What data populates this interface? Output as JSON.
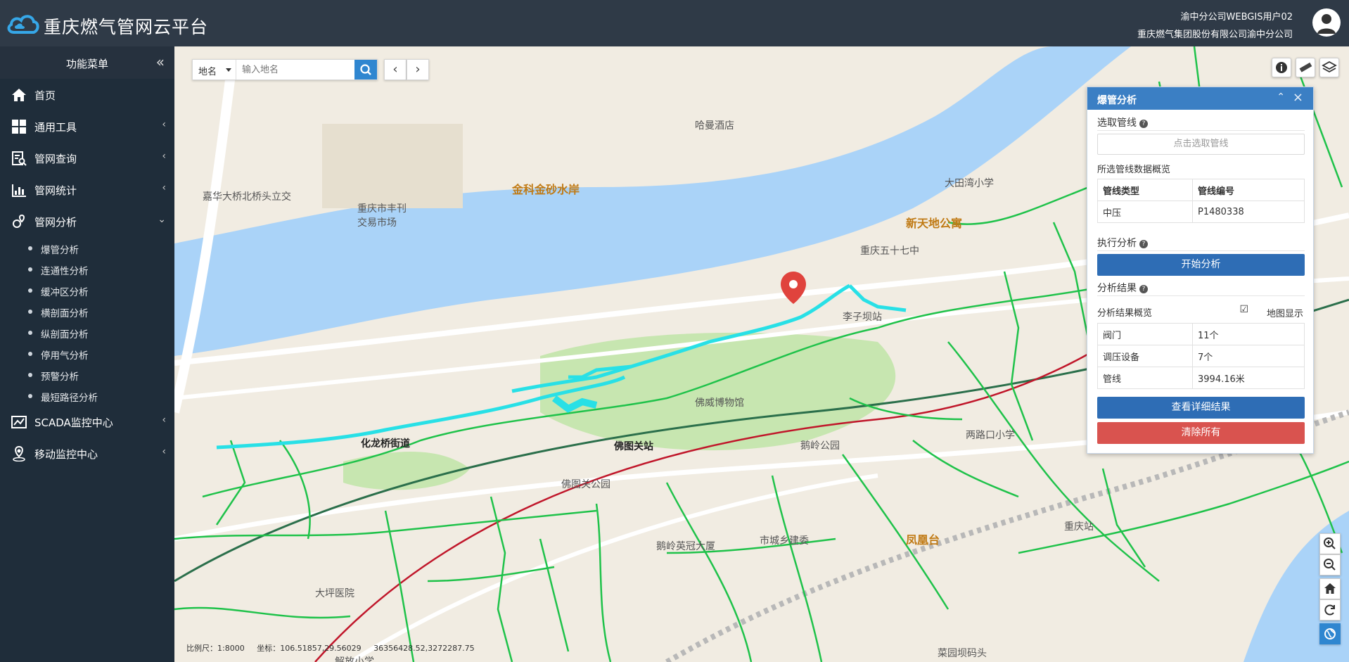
{
  "header": {
    "app_title": "重庆燃气管网云平台",
    "user_name": "渝中分公司WEBGIS用户02",
    "company": "重庆燃气集团股份有限公司渝中分公司"
  },
  "sidebar": {
    "menu_title": "功能菜单",
    "items": [
      {
        "label": "首页",
        "icon": "home-icon"
      },
      {
        "label": "通用工具",
        "icon": "grid-icon"
      },
      {
        "label": "管网查询",
        "icon": "search-doc-icon"
      },
      {
        "label": "管网统计",
        "icon": "bar-chart-icon"
      },
      {
        "label": "管网分析",
        "icon": "map-pin-icon"
      },
      {
        "label": "SCADA监控中心",
        "icon": "line-chart-icon"
      },
      {
        "label": "移动监控中心",
        "icon": "location-icon"
      }
    ],
    "analysis_sub": [
      "爆管分析",
      "连通性分析",
      "缓冲区分析",
      "横剖面分析",
      "纵剖面分析",
      "停用气分析",
      "预警分析",
      "最短路径分析"
    ]
  },
  "search": {
    "type": "地名",
    "placeholder": "输入地名"
  },
  "panel": {
    "title": "爆管分析",
    "select_section": "选取管线",
    "pick_button": "点击选取管线",
    "overview_label": "所选管线数据概览",
    "pipe_table": {
      "headers": [
        "管线类型",
        "管线编号"
      ],
      "row": [
        "中压",
        "P1480338"
      ]
    },
    "execute_section": "执行分析",
    "start_button": "开始分析",
    "result_section": "分析结果",
    "result_overview_label": "分析结果概览",
    "map_display_label": "地图显示",
    "results": [
      {
        "name": "阀门",
        "value": "11个"
      },
      {
        "name": "调压设备",
        "value": "7个"
      },
      {
        "name": "管线",
        "value": "3994.16米"
      }
    ],
    "detail_button": "查看详细结果",
    "clear_button": "清除所有"
  },
  "status": {
    "scale": "比例尺：1:8000",
    "coords": "坐标：106.51857,29.56029",
    "projected": "36356428.52,3272287.75"
  },
  "map_labels": {
    "hotel": "哈曼酒店",
    "jinke": "金科金砂水岸",
    "bridge": "嘉华大桥北桥头立交",
    "market1": "重庆市丰刊",
    "market2": "交易市场",
    "school1": "大田湾小学",
    "xintiandi": "新天地公寓",
    "school57": "重庆五十七中",
    "liziba": "李子坝站",
    "fotuguan": "佛图关站",
    "park": "佛图关公园",
    "eling": "鹅岭公园",
    "lianglukou": "两路口小学",
    "fenghuangtai": "凤凰台",
    "chongqing_station": "重庆站",
    "hualong": "化龙桥街道",
    "chengxiang": "市城乡建委",
    "yingbin": "鹅岭英冠大厦",
    "hospital": "大坪医院",
    "jiefang": "解放小学",
    "yuanzi": "菜园坝码头",
    "hotel2": "佛威博物馆"
  },
  "colors": {
    "topbar": "#2f3a47",
    "sidebar": "#1f2d3a",
    "river": "#aad3f8",
    "pipe": "#1fc24a",
    "highlight": "#28e0e6",
    "primary_button": "#2e6db5",
    "danger_button": "#d9534f"
  }
}
